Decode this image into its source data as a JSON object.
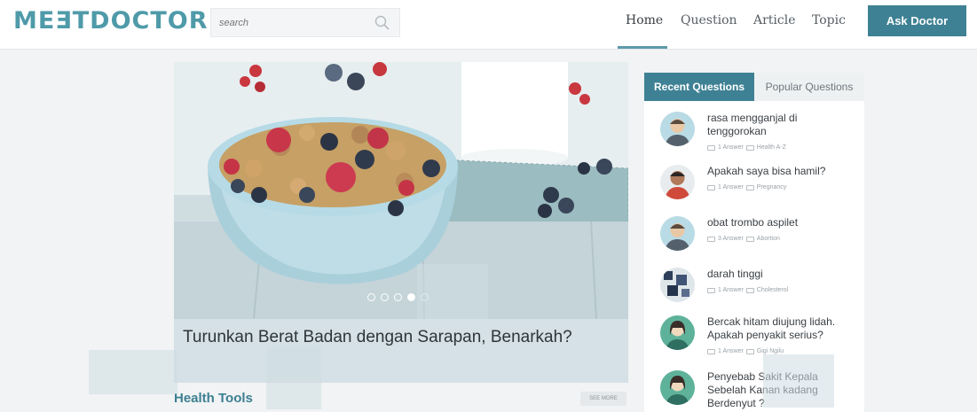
{
  "header": {
    "logo": "MEƎTDOCTOR",
    "search_placeholder": "search",
    "nav": [
      "Home",
      "Question",
      "Article",
      "Topic"
    ],
    "ask_button": "Ask Doctor"
  },
  "hero": {
    "caption": "Turunkan Berat Badan dengan Sarapan, Benarkah?",
    "slides": 5,
    "active_slide": 4
  },
  "health_tools": {
    "title": "Health Tools",
    "see_more": "SEE MORE"
  },
  "sidebar": {
    "tabs": [
      "Recent Questions",
      "Popular Questions"
    ],
    "questions": [
      {
        "title": "rasa mengganjal di tenggorokan",
        "answers": "1 Answer",
        "topic": "Health A-Z"
      },
      {
        "title": "Apakah saya bisa hamil?",
        "answers": "1 Answer",
        "topic": "Pregnancy"
      },
      {
        "title": "obat trombo aspilet",
        "answers": "3 Answer",
        "topic": "Abortion"
      },
      {
        "title": "darah tinggi",
        "answers": "1 Answer",
        "topic": "Cholesterol"
      },
      {
        "title": "Bercak hitam diujung lidah. Apakah penyakit serius?",
        "answers": "1 Answer",
        "topic": "Gigi Ngilu"
      },
      {
        "title": "Penyebab Sakit Kepala Sebelah Kanan kadang Berdenyut ?",
        "answers": "",
        "topic": ""
      }
    ]
  },
  "colors": {
    "accent": "#3f8194",
    "logo_teal": "#4f9aa9"
  }
}
